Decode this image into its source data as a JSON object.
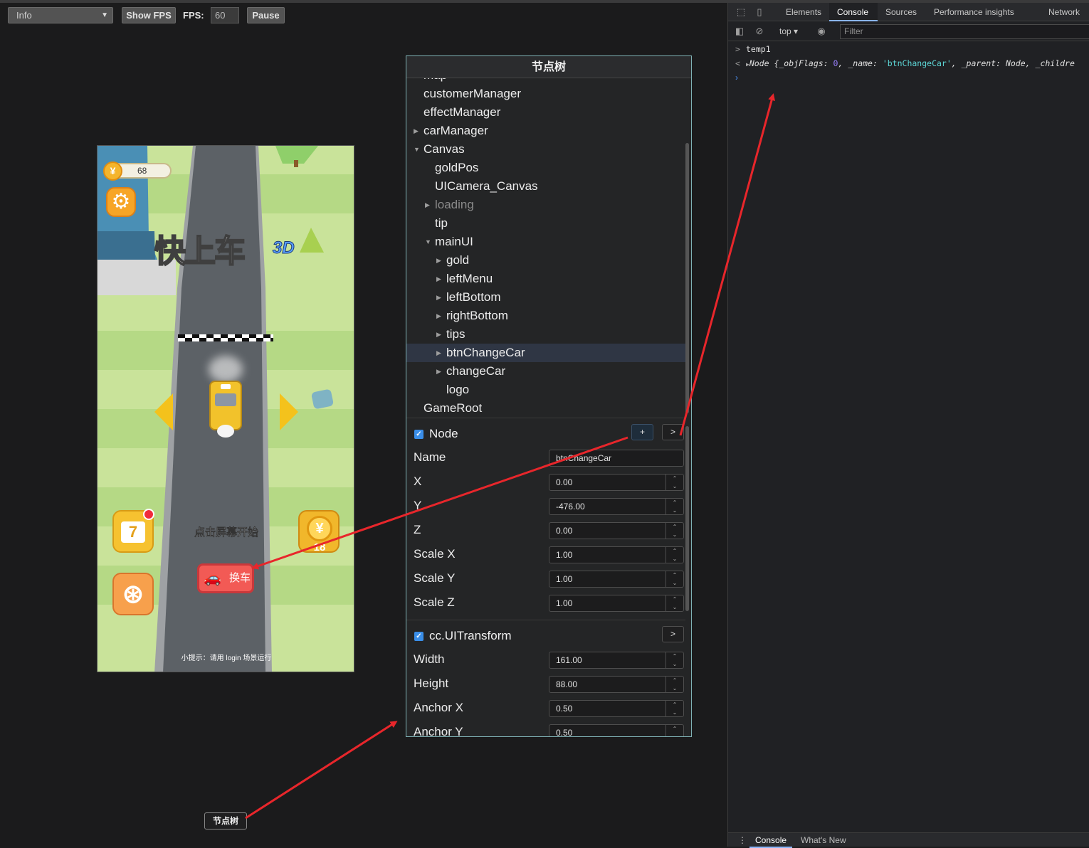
{
  "toolbar": {
    "log_level": "Info",
    "show_fps_label": "Show FPS",
    "fps_label": "FPS:",
    "fps_value": "60",
    "pause_label": "Pause"
  },
  "game": {
    "coins": "68",
    "title": "快上车",
    "title_suffix": "3D",
    "start_text": "点击屏幕开始",
    "change_car_label": "换车",
    "calendar_day": "7",
    "coin_reward": "18",
    "tip_text": "小提示：请用 login 场景运行"
  },
  "tree_panel": {
    "title": "节点树",
    "nodes": [
      {
        "label": "map",
        "indent": 0,
        "arrow": "right",
        "state": "normal"
      },
      {
        "label": "customerManager",
        "indent": 0,
        "arrow": "",
        "state": "normal"
      },
      {
        "label": "effectManager",
        "indent": 0,
        "arrow": "",
        "state": "normal"
      },
      {
        "label": "carManager",
        "indent": 0,
        "arrow": "right",
        "state": "normal"
      },
      {
        "label": "Canvas",
        "indent": 0,
        "arrow": "down",
        "state": "normal"
      },
      {
        "label": "goldPos",
        "indent": 1,
        "arrow": "",
        "state": "normal"
      },
      {
        "label": "UICamera_Canvas",
        "indent": 1,
        "arrow": "",
        "state": "normal"
      },
      {
        "label": "loading",
        "indent": 1,
        "arrow": "right",
        "state": "dim"
      },
      {
        "label": "tip",
        "indent": 1,
        "arrow": "",
        "state": "normal"
      },
      {
        "label": "mainUI",
        "indent": 1,
        "arrow": "down",
        "state": "normal"
      },
      {
        "label": "gold",
        "indent": 2,
        "arrow": "right",
        "state": "normal"
      },
      {
        "label": "leftMenu",
        "indent": 2,
        "arrow": "right",
        "state": "normal"
      },
      {
        "label": "leftBottom",
        "indent": 2,
        "arrow": "right",
        "state": "normal"
      },
      {
        "label": "rightBottom",
        "indent": 2,
        "arrow": "right",
        "state": "normal"
      },
      {
        "label": "tips",
        "indent": 2,
        "arrow": "right",
        "state": "normal"
      },
      {
        "label": "btnChangeCar",
        "indent": 2,
        "arrow": "right",
        "state": "selected"
      },
      {
        "label": "changeCar",
        "indent": 2,
        "arrow": "right",
        "state": "normal"
      },
      {
        "label": "logo",
        "indent": 2,
        "arrow": "",
        "state": "normal"
      },
      {
        "label": "GameRoot",
        "indent": 0,
        "arrow": "",
        "state": "normal"
      }
    ],
    "node_section": {
      "title": "Node",
      "add_label": "+",
      "log_label": ">",
      "props": [
        {
          "label": "Name",
          "value": "btnChangeCar",
          "spin": false
        },
        {
          "label": "X",
          "value": "0.00",
          "spin": true
        },
        {
          "label": "Y",
          "value": "-476.00",
          "spin": true
        },
        {
          "label": "Z",
          "value": "0.00",
          "spin": true
        },
        {
          "label": "Scale X",
          "value": "1.00",
          "spin": true
        },
        {
          "label": "Scale Y",
          "value": "1.00",
          "spin": true
        },
        {
          "label": "Scale Z",
          "value": "1.00",
          "spin": true
        }
      ]
    },
    "transform_section": {
      "title": "cc.UITransform",
      "log_label": ">",
      "props": [
        {
          "label": "Width",
          "value": "161.00",
          "spin": true
        },
        {
          "label": "Height",
          "value": "88.00",
          "spin": true
        },
        {
          "label": "Anchor X",
          "value": "0.50",
          "spin": true
        },
        {
          "label": "Anchor Y",
          "value": "0.50",
          "spin": true
        }
      ]
    }
  },
  "tree_button_label": "节点树",
  "devtools": {
    "tabs": [
      "Elements",
      "Console",
      "Sources",
      "Performance insights",
      "Network"
    ],
    "active_tab": "Console",
    "context": "top",
    "filter_placeholder": "Filter",
    "console": {
      "input_line": "temp1",
      "output_prefix": "Node {",
      "output_key1": "_objFlags",
      "output_val1": "0",
      "output_key2": "_name",
      "output_val2": "'btnChangeCar'",
      "output_key3": "_parent",
      "output_val3": "Node",
      "output_key4": "_childre"
    },
    "drawer_tabs": [
      "Console",
      "What's New"
    ]
  },
  "colors": {
    "annotation_arrow": "#e8262b",
    "panel_border": "#7fb2b5",
    "selected_row": "#2f3644",
    "checkbox": "#3a8ee8",
    "devtools_accent": "#8ab4f8"
  }
}
